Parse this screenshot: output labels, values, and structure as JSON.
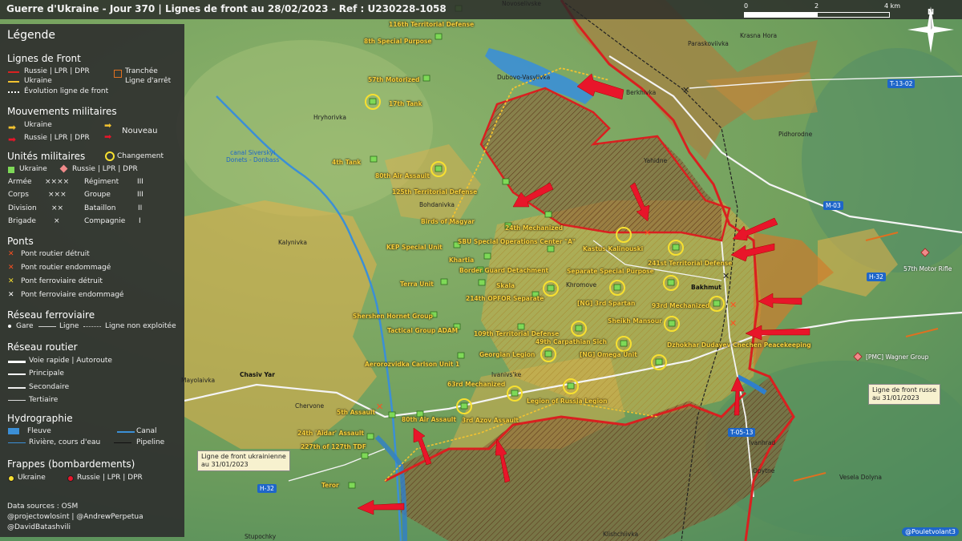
{
  "header": {
    "title": "Guerre d'Ukraine - Jour 370 | Lignes de front au 28/02/2023 - Ref : U230228-1058",
    "scale_labels": [
      "0",
      "2",
      "4 km"
    ],
    "north_label": "N"
  },
  "legend": {
    "title": "Légende",
    "front": {
      "heading": "Lignes de Front",
      "russia": "Russie | LPR | DPR",
      "ukraine": "Ukraine",
      "evolution": "Évolution ligne de front",
      "trench_line1": "Tranchée",
      "trench_line2": "Ligne d'arrêt"
    },
    "movements": {
      "heading": "Mouvements militaires",
      "ukraine": "Ukraine",
      "russia": "Russie | LPR | DPR",
      "new": "Nouveau"
    },
    "units": {
      "heading": "Unités militaires",
      "change": "Changement",
      "ukraine": "Ukraine",
      "russia": "Russie | LPR | DPR",
      "rows": [
        {
          "a": "Armée",
          "as": "××××",
          "b": "Régiment",
          "bs": "III"
        },
        {
          "a": "Corps",
          "as": "×××",
          "b": "Groupe",
          "bs": "III"
        },
        {
          "a": "Division",
          "as": "××",
          "b": "Bataillon",
          "bs": "II"
        },
        {
          "a": "Brigade",
          "as": "×",
          "b": "Compagnie",
          "bs": "I"
        }
      ]
    },
    "bridges": {
      "heading": "Ponts",
      "items": [
        "Pont routier détruit",
        "Pont routier endommagé",
        "Pont ferroviaire détruit",
        "Pont ferroviaire endommagé"
      ]
    },
    "rail": {
      "heading": "Réseau ferroviaire",
      "station": "Gare",
      "line": "Ligne",
      "unused": "Ligne non exploitée"
    },
    "road": {
      "heading": "Réseau routier",
      "items": [
        "Voie rapide | Autoroute",
        "Principale",
        "Secondaire",
        "Tertiaire"
      ]
    },
    "hydro": {
      "heading": "Hydrographie",
      "river_big": "Fleuve",
      "canal": "Canal",
      "river": "Rivière, cours d'eau",
      "pipeline": "Pipeline"
    },
    "strikes": {
      "heading": "Frappes (bombardements)",
      "ukraine": "Ukraine",
      "russia": "Russie | LPR | DPR"
    },
    "sources": {
      "line1": "Data sources : OSM",
      "line2": "@projectowlosint | @AndrewPerpetua",
      "line3": "@DavidBatashvili"
    }
  },
  "colors": {
    "russia": "#d92020",
    "ukraine": "#f2c230",
    "russia_zone": "#9a5a2e",
    "ukraine_zone": "#e6b04a",
    "contested": "#d8a33a",
    "terrain": "#6f9e5c",
    "legend_bg": "#2d2d2d"
  },
  "units": [
    "116th Territorial Defense",
    "8th Special Purpose",
    "57th Motorized",
    "17th Tank",
    "4th Tank",
    "80th Air Assault",
    "125th Territorial Defense",
    "24th Mechanized",
    "Birds of Magyar",
    "KEP Special Unit",
    "SBU Special Operations Center \"A\"",
    "Kastus Kalinouski",
    "Khartia",
    "241st Territorial Defense",
    "Border Guard Detachment",
    "Separate Special Purpose",
    "Terra Unit",
    "Skala",
    "214th OPFOR Separate",
    "[NG] 3rd Spartan",
    "93rd Mechanized",
    "Shershen Hornet Group",
    "Sheikh Mansour",
    "Tactical Group ADAM",
    "109th Territorial Defense",
    "49th Carpathian Sich",
    "Dzhokhar Dudayev Chechen Peacekeeping",
    "Georgian Legion",
    "[NG] Omega Unit",
    "Aerorozvidka Carlson Unit 1",
    "63rd Mechanized",
    "Legion of Russia Legion",
    "5th Assault",
    "80th Air Assault",
    "3rd Azov Assault",
    "24th 'Aidar' Assault",
    "227th of 127th TDF",
    "Teror"
  ],
  "russian_units": [
    "57th Motor Rifle",
    "[PMC] Wagner Group"
  ],
  "places": [
    "Novoselivske",
    "Paraskoviivka",
    "Krasna Hora",
    "Dubovo-Vasylivka",
    "Berkhivka",
    "Hryhorivka",
    "Pidhorodne",
    "Yahidne",
    "Bohdanivka",
    "Kalynivka",
    "Khromove",
    "Bakhmut",
    "Ivanivs'ke",
    "Chasiv Yar",
    "Mayolaivka",
    "Ivanhrad",
    "Opytne",
    "Vesela Dolyna",
    "Stupochky",
    "Klishchiivka",
    "Chervone"
  ],
  "canal_label_1": "canal Siverskyi",
  "canal_label_2": "Donets - Donbass",
  "roads": [
    "T-13-02",
    "M-03",
    "H-32",
    "H-32",
    "T-05-13"
  ],
  "notes": {
    "ukr_line1": "Ligne de front ukrainienne",
    "ukr_line2": "au 31/01/2023",
    "rus_line1": "Ligne de front russe",
    "rus_line2": "au 31/01/2023"
  },
  "credit": "@Pouletvolant3"
}
